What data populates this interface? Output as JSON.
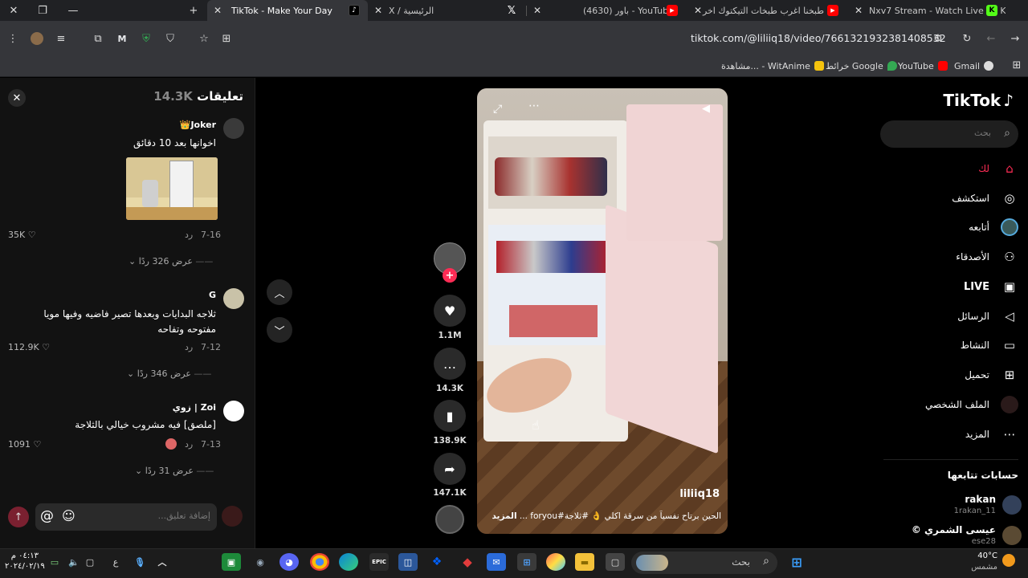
{
  "browser": {
    "tabs": [
      {
        "title": "Nxv7 Stream - Watch Live on K",
        "favicon": "kick-icon",
        "color": "#53fc18"
      },
      {
        "title": "طبخنا اغرب طبخات التيكتوك اخر",
        "favicon": "youtube-icon",
        "color": "#ff0000"
      },
      {
        "title": "(4630) باور - YouTube",
        "favicon": "youtube-icon",
        "color": "#ff0000"
      },
      {
        "title": "الرئيسية / X",
        "favicon": "x-icon",
        "color": "#ffffff"
      },
      {
        "title": "TikTok - Make Your Day",
        "favicon": "tiktok-icon",
        "color": "#ffffff"
      }
    ],
    "url": "tiktok.com/@liliiq18/video/7661321932381408532",
    "bookmarks": [
      {
        "label": "Gmail",
        "color": "#ea4335"
      },
      {
        "label": "YouTube",
        "color": "#ff0000"
      },
      {
        "label": "خرائط Google",
        "color": "#34a853"
      },
      {
        "label": "مشاهدة... - WitAnime",
        "color": "#f4c20d"
      }
    ]
  },
  "sidebar": {
    "logo": "TikTok",
    "search_placeholder": "بحث",
    "nav": [
      {
        "label": "لك",
        "icon": "home-icon",
        "active": true
      },
      {
        "label": "استكشف",
        "icon": "compass-icon",
        "active": false
      },
      {
        "label": "أتابعه",
        "icon": "following-icon",
        "active": false
      },
      {
        "label": "الأصدقاء",
        "icon": "friends-icon",
        "active": false
      },
      {
        "label": "LIVE",
        "icon": "live-icon",
        "active": false
      },
      {
        "label": "الرسائل",
        "icon": "messages-icon",
        "active": false
      },
      {
        "label": "النشاط",
        "icon": "activity-icon",
        "active": false
      },
      {
        "label": "تحميل",
        "icon": "upload-icon",
        "active": false
      },
      {
        "label": "الملف الشخصي",
        "icon": "profile-icon",
        "active": false
      },
      {
        "label": "المزيد",
        "icon": "more-icon",
        "active": false
      }
    ],
    "following_title": "حسابات تتابعها",
    "following": [
      {
        "name": "rakan",
        "handle": "1rakan_11"
      },
      {
        "name": "عيسى الشمري ©",
        "handle": "ese28"
      }
    ]
  },
  "video": {
    "author": "liliiq18",
    "caption": "الحين برتاح نفسياً من سرقة اكلي 👌 #ثلاجة#foryou ...",
    "more_label": "المزيد",
    "likes": "1.1M",
    "comments": "14.3K",
    "saves": "138.9K",
    "shares": "147.1K"
  },
  "comments": {
    "title": "تعليقات",
    "count": "14.3K",
    "input_placeholder": "إضافة تعليق...",
    "items": [
      {
        "name": "Joker👑",
        "text": "اخوانها بعد 10 دقائق",
        "date": "7-16",
        "reply": "رد",
        "likes": "35K",
        "view_replies": "عرض 326 ردًا"
      },
      {
        "name": "G",
        "text": "ثلاجه البدايات وبعدها تصير فاضيه وفيها مويا مفتوحه وتفاحه",
        "date": "7-12",
        "reply": "رد",
        "likes": "112.9K",
        "view_replies": "عرض 346 ردًا"
      },
      {
        "name": "Zoi | زوي",
        "text": "[ملصق] فيه مشروب خيالي بالثلاجة",
        "date": "7-13",
        "reply": "رد",
        "likes": "1091",
        "view_replies": "عرض 31 ردًا"
      }
    ]
  },
  "taskbar": {
    "temperature": "40°C",
    "weather": "مشمس",
    "search_placeholder": "بحث",
    "time": "٠٤:١٣ م",
    "date": "٢٠٢٤/٠٢/١٩",
    "lang": "ع"
  }
}
